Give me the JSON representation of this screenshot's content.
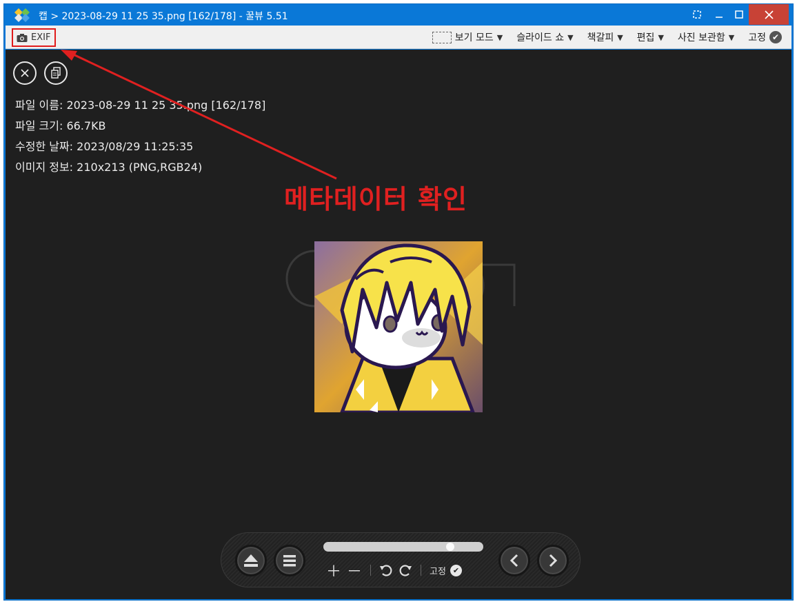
{
  "window": {
    "title": "캡 > 2023-08-29 11 25 35.png [162/178] - 꿀뷰 5.51"
  },
  "menubar": {
    "exif_label": "EXIF",
    "view_mode": "보기 모드",
    "slideshow": "슬라이드 쇼",
    "bookmark": "책갈피",
    "edit": "편집",
    "photo_vault": "사진 보관함",
    "pin": "고정"
  },
  "info": {
    "file_name": "파일 이름: 2023-08-29 11 25 35.png [162/178]",
    "file_size": "파일 크기: 66.7KB",
    "modified_date": "수정한 날짜: 2023/08/29 11:25:35",
    "image_info": "이미지 정보: 210x213 (PNG,RGB24)"
  },
  "annotation": {
    "text": "메타데이터 확인",
    "color": "#e02020"
  },
  "controlbar": {
    "pin_label": "고정",
    "zoom_level_fraction": 0.81
  },
  "colors": {
    "titlebar": "#0a78d7",
    "close_button": "#c84236",
    "viewer_bg": "#1f1f1f"
  }
}
